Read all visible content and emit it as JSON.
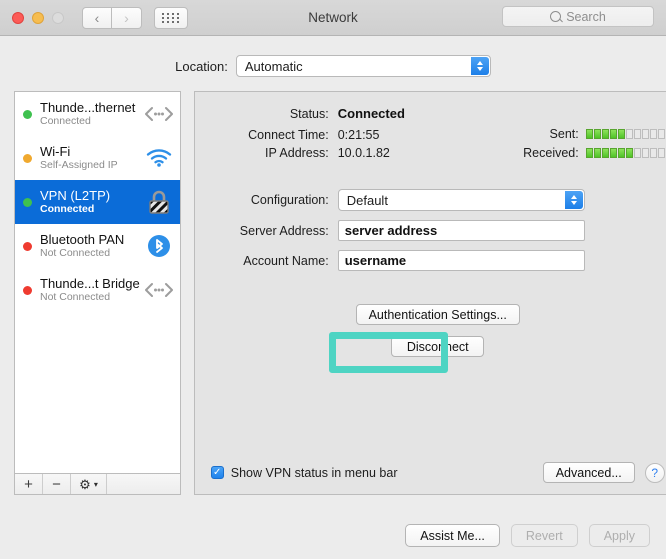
{
  "window": {
    "title": "Network",
    "traffic_lights": [
      "close",
      "minimize",
      "zoom"
    ],
    "nav_back": "‹",
    "nav_forward": "›",
    "grid_button": "show-all-icon"
  },
  "search": {
    "placeholder": "Search",
    "icon": "search-icon"
  },
  "location": {
    "label": "Location:",
    "value": "Automatic"
  },
  "sidebar": {
    "services": [
      {
        "name": "Thunde...thernet",
        "status": "Connected",
        "dot": "#3fc14f",
        "icon": "ethernet-icon"
      },
      {
        "name": "Wi-Fi",
        "status": "Self-Assigned IP",
        "dot": "#f0a92f",
        "icon": "wifi-icon"
      },
      {
        "name": "VPN (L2TP)",
        "status": "Connected",
        "dot": "#3fc14f",
        "icon": "vpn-lock-icon"
      },
      {
        "name": "Bluetooth PAN",
        "status": "Not Connected",
        "dot": "#ef3b30",
        "icon": "bluetooth-icon"
      },
      {
        "name": "Thunde...t Bridge",
        "status": "Not Connected",
        "dot": "#ef3b30",
        "icon": "ethernet-icon"
      }
    ],
    "toolbar": {
      "add": "+",
      "remove": "−",
      "actions_icon": "gear-icon",
      "actions_chevron": "▾"
    }
  },
  "detail": {
    "status_label": "Status:",
    "status_value": "Connected",
    "connect_time_label": "Connect Time:",
    "connect_time_value": "0:21:55",
    "ip_label": "IP Address:",
    "ip_value": "10.0.1.82",
    "sent_label": "Sent:",
    "received_label": "Received:",
    "sent_filled": 5,
    "sent_total": 10,
    "received_filled": 6,
    "received_total": 10,
    "configuration_label": "Configuration:",
    "configuration_value": "Default",
    "server_label": "Server Address:",
    "server_value": "server address",
    "account_label": "Account Name:",
    "account_value": "username",
    "auth_button": "Authentication Settings...",
    "disconnect_button": "Disconnect",
    "checkbox_label": "Show VPN status in menu bar",
    "checkbox_checked": true,
    "checkbox_mark": "✓",
    "advanced_button": "Advanced...",
    "help_button": "?"
  },
  "footer": {
    "assist_button": "Assist Me...",
    "revert_button": "Revert",
    "apply_button": "Apply"
  },
  "colors": {
    "highlight": "#4ed4c3",
    "selection": "#0b6cd8",
    "meter_green": "#4fc427",
    "accent_blue": "#1f82ec"
  }
}
